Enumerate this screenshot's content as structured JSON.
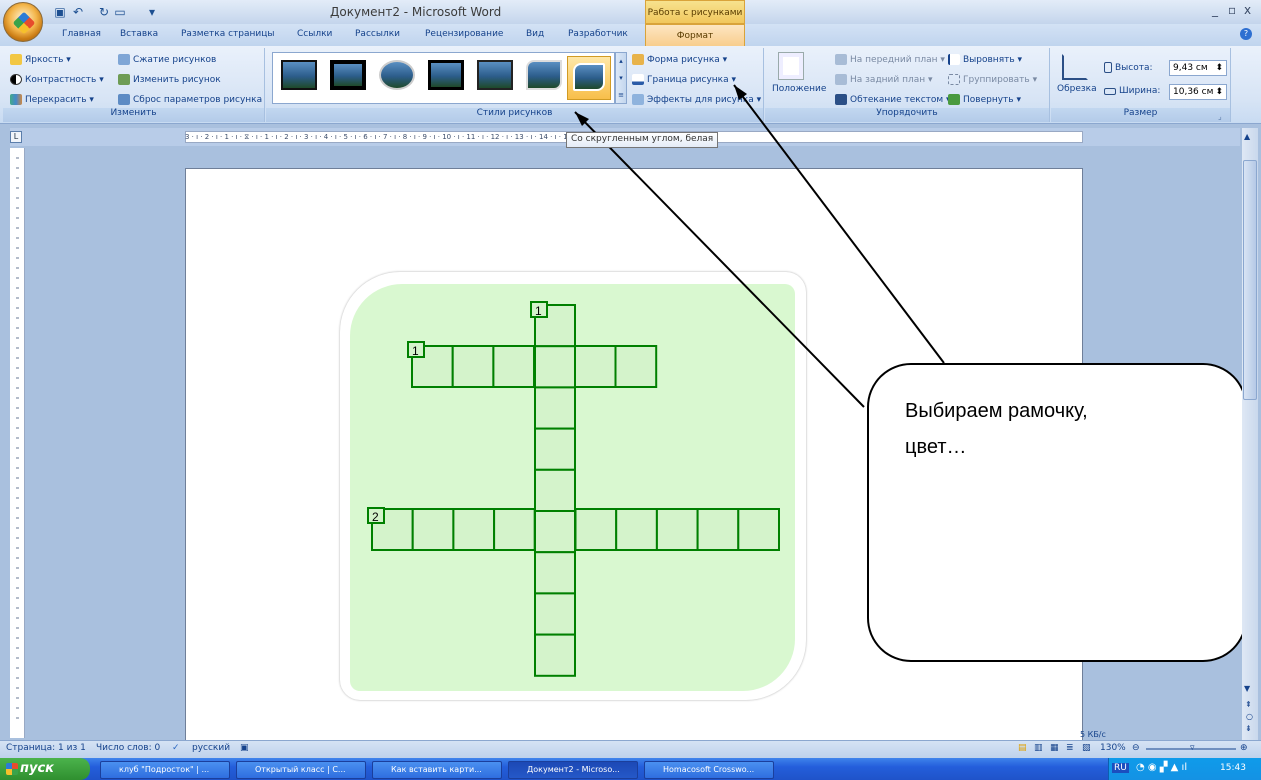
{
  "window": {
    "title": "Документ2 - Microsoft Word",
    "context_tab_group": "Работа с рисунками",
    "controls": [
      "_",
      "▫",
      "x"
    ]
  },
  "tabs": [
    "Главная",
    "Вставка",
    "Разметка страницы",
    "Ссылки",
    "Рассылки",
    "Рецензирование",
    "Вид",
    "Разработчик",
    "Формат"
  ],
  "ribbon": {
    "adjust": {
      "label": "Изменить",
      "brightness": "Яркость ▾",
      "contrast": "Контрастность ▾",
      "recolor": "Перекрасить ▾",
      "compress": "Сжатие рисунков",
      "change": "Изменить рисунок",
      "reset": "Сброс параметров рисунка"
    },
    "styles": {
      "label": "Стили рисунков",
      "shape": "Форма рисунка ▾",
      "border": "Граница рисунка ▾",
      "effects": "Эффекты для рисунка ▾"
    },
    "arrange": {
      "label": "Упорядочить",
      "position": "Положение",
      "bring_front": "На передний план ▾",
      "send_back": "На задний план ▾",
      "wrap": "Обтекание текстом ▾",
      "align": "Выровнять ▾",
      "group": "Группировать ▾",
      "rotate": "Повернуть ▾"
    },
    "size": {
      "label": "Размер",
      "crop": "Обрезка",
      "height_label": "Высота:",
      "height_value": "9,43 см",
      "width_label": "Ширина:",
      "width_value": "10,36 см"
    }
  },
  "tooltip": "Со скругленным углом, белая",
  "ruler": {
    "text": "3 · ı · 2 · ı · 1 · ı · ⧖ · ı · 1 · ı · 2 · ı · 3 · ı · 4 · ı · 5 · ı · 6 · ı · 7 · ı · 8 · ı · 9 · ı · 10 · ı · 11 · ı · 12 · ı · 13 · ı · 14 · ı · 15 · ı · 16 · △ · 17 · ı ·",
    "corner": "L"
  },
  "crossword": {
    "clue_numbers": [
      "1",
      "1",
      "2"
    ]
  },
  "callout": {
    "line1": "Выбираем рамочку,",
    "line2": "цвет…"
  },
  "status": {
    "page": "Страница: 1 из 1",
    "words": "Число слов: 0",
    "language": "русский",
    "net": "5 КБ/с",
    "zoom": "130%"
  },
  "taskbar": {
    "start": "пуск",
    "tasks": [
      "клуб \"Подросток\" | ...",
      "Открытый класс | С...",
      "Как вставить карти...",
      "Документ2 - Microso...",
      "Homacosoft Crosswo..."
    ],
    "lang": "RU",
    "clock": "15:43"
  },
  "colors": {
    "grid_stroke": "#008000",
    "cell_fill": "#d4f3cb",
    "picture_bg": "#d9f8d0",
    "ribbon_blue": "#15428b"
  }
}
